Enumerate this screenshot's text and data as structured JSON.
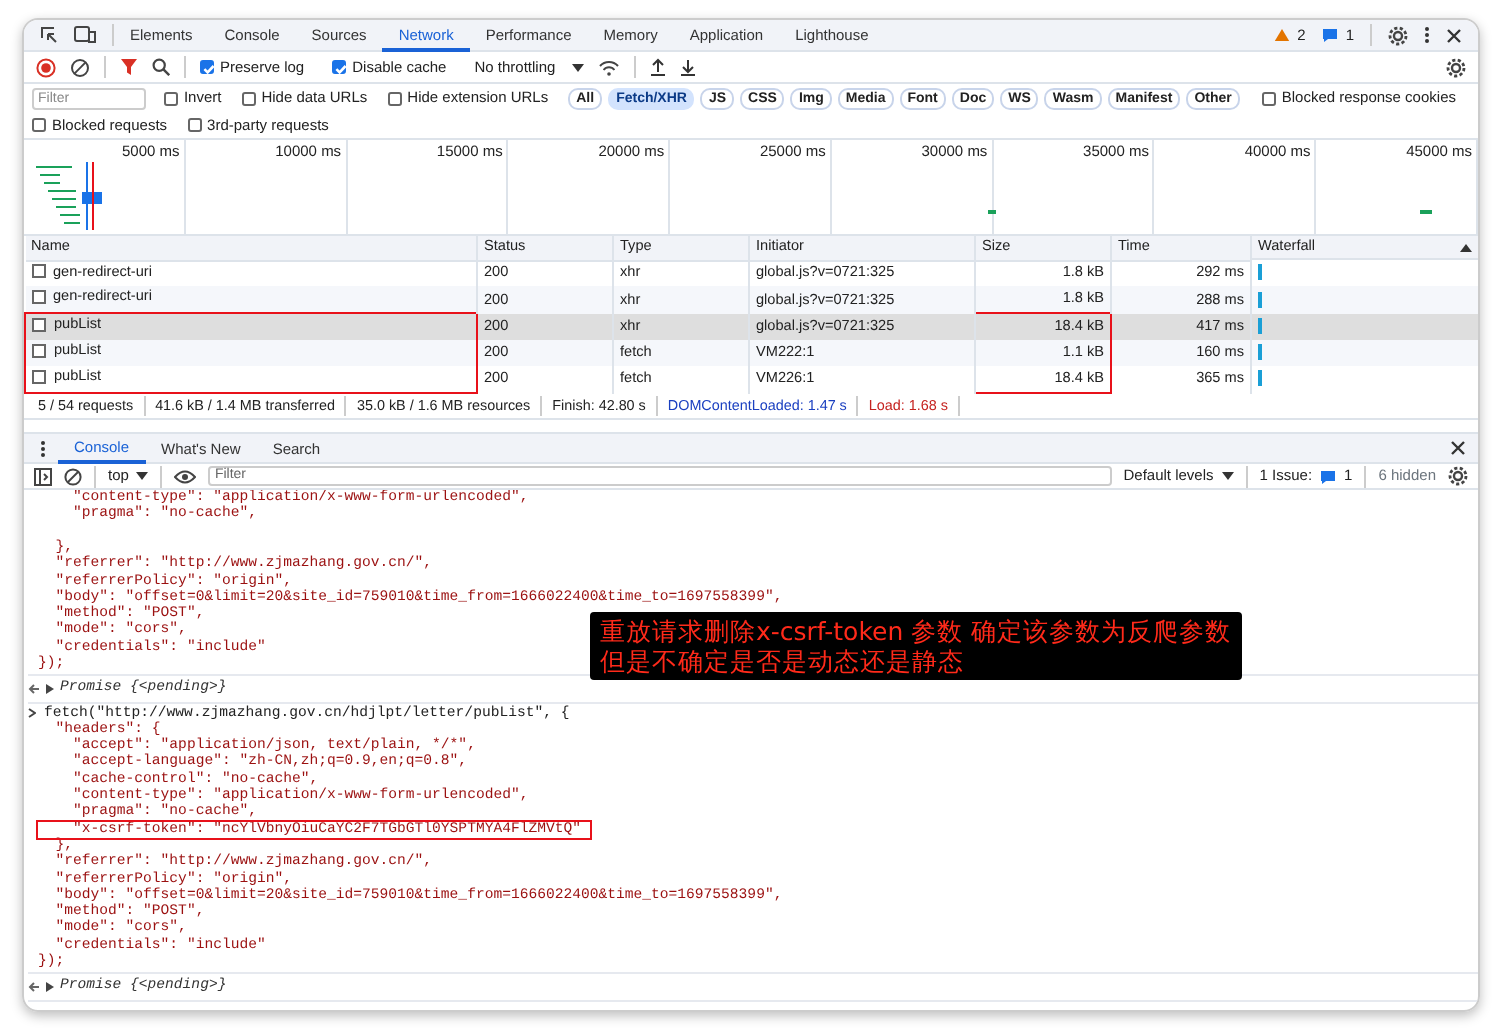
{
  "tabs": [
    {
      "label": "Elements",
      "selected": false
    },
    {
      "label": "Console",
      "selected": false
    },
    {
      "label": "Sources",
      "selected": false
    },
    {
      "label": "Network",
      "selected": true
    },
    {
      "label": "Performance",
      "selected": false
    },
    {
      "label": "Memory",
      "selected": false
    },
    {
      "label": "Application",
      "selected": false
    },
    {
      "label": "Lighthouse",
      "selected": false
    }
  ],
  "issue_counts": {
    "warnings": "2",
    "messages": "1"
  },
  "toolbar": {
    "checks": [
      {
        "label": "Preserve log",
        "checked": true
      },
      {
        "label": "Disable cache",
        "checked": true
      }
    ],
    "throttling": "No throttling"
  },
  "filter": {
    "placeholder": "Filter",
    "options": [
      {
        "label": "Invert",
        "checked": false
      },
      {
        "label": "Hide data URLs",
        "checked": false
      },
      {
        "label": "Hide extension URLs",
        "checked": false
      }
    ],
    "types": [
      {
        "label": "All",
        "selected": false
      },
      {
        "label": "Fetch/XHR",
        "selected": true
      },
      {
        "label": "JS",
        "selected": false
      },
      {
        "label": "CSS",
        "selected": false
      },
      {
        "label": "Img",
        "selected": false
      },
      {
        "label": "Media",
        "selected": false
      },
      {
        "label": "Font",
        "selected": false
      },
      {
        "label": "Doc",
        "selected": false
      },
      {
        "label": "WS",
        "selected": false
      },
      {
        "label": "Wasm",
        "selected": false
      },
      {
        "label": "Manifest",
        "selected": false
      },
      {
        "label": "Other",
        "selected": false
      }
    ],
    "more_options": [
      {
        "label": "Blocked response cookies",
        "checked": false
      },
      {
        "label": "Blocked requests",
        "checked": false
      },
      {
        "label": "3rd-party requests",
        "checked": false
      }
    ]
  },
  "timeline": {
    "ticks": [
      "5000 ms",
      "10000 ms",
      "15000 ms",
      "20000 ms",
      "25000 ms",
      "30000 ms",
      "35000 ms",
      "40000 ms",
      "45000 ms"
    ]
  },
  "table": {
    "columns": [
      "Name",
      "Status",
      "Type",
      "Initiator",
      "Size",
      "Time",
      "Waterfall"
    ],
    "rows": [
      {
        "name": "gen-redirect-uri",
        "status": "200",
        "type": "xhr",
        "initiator": "global.js?v=0721:325",
        "size": "1.8 kB",
        "time": "292 ms",
        "selected": false,
        "name_outlined": false,
        "size_outlined": false
      },
      {
        "name": "gen-redirect-uri",
        "status": "200",
        "type": "xhr",
        "initiator": "global.js?v=0721:325",
        "size": "1.8 kB",
        "time": "288 ms",
        "selected": false,
        "name_outlined": false,
        "size_outlined": false
      },
      {
        "name": "pubList",
        "status": "200",
        "type": "xhr",
        "initiator": "global.js?v=0721:325",
        "size": "18.4 kB",
        "time": "417 ms",
        "selected": true,
        "name_outlined": true,
        "size_outlined": true
      },
      {
        "name": "pubList",
        "status": "200",
        "type": "fetch",
        "initiator": "VM222:1",
        "size": "1.1 kB",
        "time": "160 ms",
        "selected": false,
        "name_outlined": true,
        "size_outlined": true
      },
      {
        "name": "pubList",
        "status": "200",
        "type": "fetch",
        "initiator": "VM226:1",
        "size": "18.4 kB",
        "time": "365 ms",
        "selected": false,
        "name_outlined": true,
        "size_outlined": true
      }
    ]
  },
  "status_bar": [
    {
      "text": "5 / 54 requests",
      "kind": "plain"
    },
    {
      "text": "41.6 kB / 1.4 MB transferred",
      "kind": "plain"
    },
    {
      "text": "35.0 kB / 1.6 MB resources",
      "kind": "plain"
    },
    {
      "text": "Finish: 42.80 s",
      "kind": "plain"
    },
    {
      "text": "DOMContentLoaded: 1.47 s",
      "kind": "dom"
    },
    {
      "text": "Load: 1.68 s",
      "kind": "load"
    }
  ],
  "drawer": {
    "tabs": [
      {
        "label": "Console",
        "selected": true
      },
      {
        "label": "What's New",
        "selected": false
      },
      {
        "label": "Search",
        "selected": false
      }
    ],
    "context": "top",
    "filter_placeholder": "Filter",
    "levels": "Default levels",
    "issues_label": "1 Issue:",
    "issues_count": "1",
    "hidden": "6 hidden"
  },
  "console": [
    {
      "kind": "code",
      "text": "    \"content-type\": \"application/x-www-form-urlencoded\",",
      "boxed": false
    },
    {
      "kind": "code",
      "text": "    \"pragma\": \"no-cache\",",
      "boxed": false
    },
    {
      "kind": "blank",
      "boxed": false
    },
    {
      "kind": "code",
      "text": "  },",
      "boxed": false
    },
    {
      "kind": "code",
      "text": "  \"referrer\": \"http://www.zjmazhang.gov.cn/\",",
      "boxed": false
    },
    {
      "kind": "code",
      "text": "  \"referrerPolicy\": \"origin\",",
      "boxed": false
    },
    {
      "kind": "code",
      "text": "  \"body\": \"offset=0&limit=20&site_id=759010&time_from=1666022400&time_to=1697558399\",",
      "boxed": false
    },
    {
      "kind": "code",
      "text": "  \"method\": \"POST\",",
      "boxed": false
    },
    {
      "kind": "code",
      "text": "  \"mode\": \"cors\",",
      "boxed": false
    },
    {
      "kind": "code",
      "text": "  \"credentials\": \"include\"",
      "boxed": false
    },
    {
      "kind": "code",
      "text": "});",
      "boxed": false
    },
    {
      "kind": "result",
      "text": "*Promise* {<pending>}",
      "boxed": false
    },
    {
      "kind": "input",
      "text": "fetch(\"http://www.zjmazhang.gov.cn/hdjlpt/letter/pubList\", {",
      "boxed": false
    },
    {
      "kind": "code",
      "text": "  \"headers\": {",
      "boxed": false
    },
    {
      "kind": "code",
      "text": "    \"accept\": \"application/json, text/plain, */*\",",
      "boxed": false
    },
    {
      "kind": "code",
      "text": "    \"accept-language\": \"zh-CN,zh;q=0.9,en;q=0.8\",",
      "boxed": false
    },
    {
      "kind": "code",
      "text": "    \"cache-control\": \"no-cache\",",
      "boxed": false
    },
    {
      "kind": "code",
      "text": "    \"content-type\": \"application/x-www-form-urlencoded\",",
      "boxed": false
    },
    {
      "kind": "code",
      "text": "    \"pragma\": \"no-cache\",",
      "boxed": false
    },
    {
      "kind": "code",
      "text": "    \"x-csrf-token\": \"ncYlVbnyOiuCaYC2F7TGbGTl0YSPTMYA4FlZMVtQ\"",
      "boxed": true
    },
    {
      "kind": "code",
      "text": "  },",
      "boxed": false
    },
    {
      "kind": "code",
      "text": "  \"referrer\": \"http://www.zjmazhang.gov.cn/\",",
      "boxed": false
    },
    {
      "kind": "code",
      "text": "  \"referrerPolicy\": \"origin\",",
      "boxed": false
    },
    {
      "kind": "code",
      "text": "  \"body\": \"offset=0&limit=20&site_id=759010&time_from=1666022400&time_to=1697558399\",",
      "boxed": false
    },
    {
      "kind": "code",
      "text": "  \"method\": \"POST\",",
      "boxed": false
    },
    {
      "kind": "code",
      "text": "  \"mode\": \"cors\",",
      "boxed": false
    },
    {
      "kind": "code",
      "text": "  \"credentials\": \"include\"",
      "boxed": false
    },
    {
      "kind": "code",
      "text": "});",
      "boxed": false
    },
    {
      "kind": "result",
      "text": "*Promise* {<pending>}",
      "boxed": false
    }
  ],
  "annotation": {
    "lines": [
      "重放请求删除x-csrf-token 参数 确定该参数为反爬参数",
      "但是不确定是否是动态还是静态"
    ]
  }
}
